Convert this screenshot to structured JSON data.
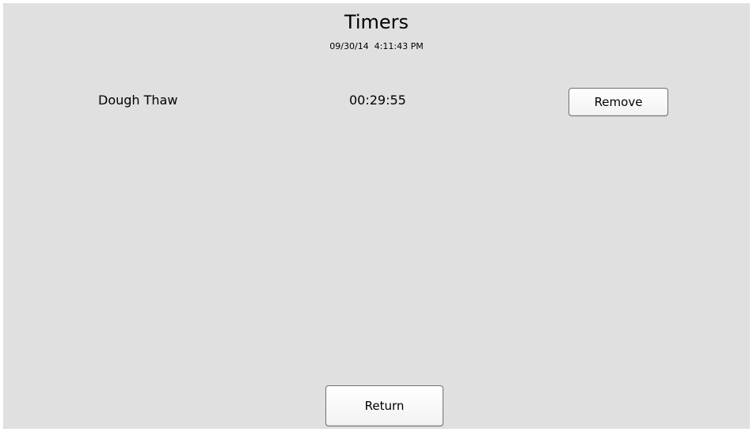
{
  "header": {
    "title": "Timers",
    "datetime": "09/30/14  4:11:43 PM"
  },
  "timers": [
    {
      "name": "Dough Thaw",
      "remaining": "00:29:55",
      "remove_label": "Remove"
    }
  ],
  "footer": {
    "return_label": "Return"
  },
  "colors": {
    "background": "#e0e0e0",
    "button_border": "#707070",
    "button_face": "#ffffff"
  }
}
